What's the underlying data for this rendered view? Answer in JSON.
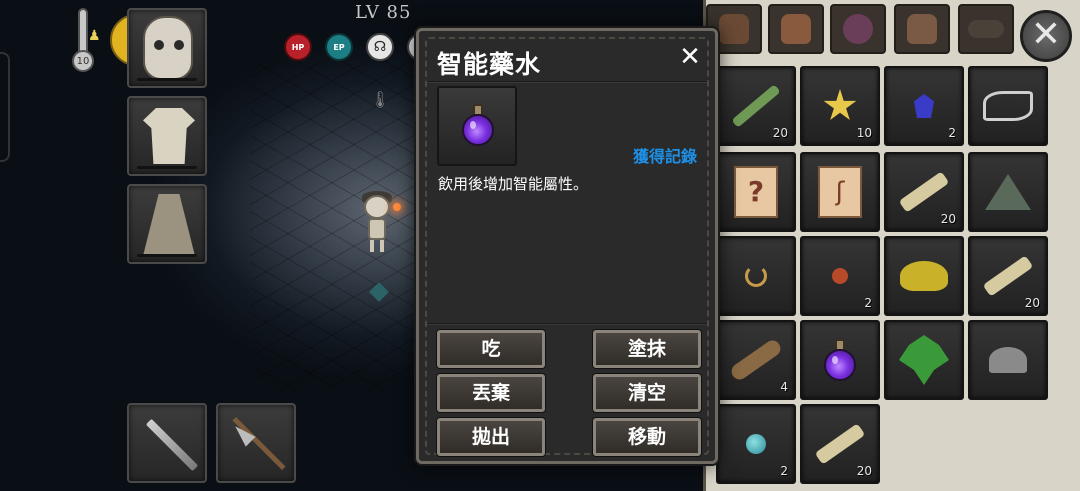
{
  "hud": {
    "level": "LV 85",
    "temperature": "10",
    "stats": [
      "HP",
      "EP"
    ]
  },
  "modal": {
    "title": "智能藥水",
    "close_symbol": "✕",
    "obtain_record": "獲得記錄",
    "description": "飲用後增加智能屬性。",
    "buttons": {
      "eat": "吃",
      "smear": "塗抹",
      "discard": "丟棄",
      "clear": "清空",
      "throw": "拋出",
      "move": "移動"
    }
  },
  "inventory": {
    "close_symbol": "✕",
    "bag_tabs": [
      {
        "name": "backpack-brown"
      },
      {
        "name": "backpack-orange"
      },
      {
        "name": "pouch-purple"
      },
      {
        "name": "backpack-tan"
      },
      {
        "name": "creature-bag"
      }
    ],
    "items": [
      {
        "name": "grass-bundle",
        "count": "20"
      },
      {
        "name": "star-crystal",
        "count": "10"
      },
      {
        "name": "dark-gem",
        "count": "2"
      },
      {
        "name": "skeleton-fossil",
        "count": ""
      },
      {
        "name": "mystery-scroll",
        "count": ""
      },
      {
        "name": "rune-scroll",
        "count": ""
      },
      {
        "name": "straw-bundle",
        "count": "20"
      },
      {
        "name": "tent-cloth",
        "count": ""
      },
      {
        "name": "worm",
        "count": ""
      },
      {
        "name": "red-berry",
        "count": "2"
      },
      {
        "name": "yellow-powder",
        "count": ""
      },
      {
        "name": "straw-bundle",
        "count": "20"
      },
      {
        "name": "wood-log",
        "count": "4"
      },
      {
        "name": "intelligence-potion",
        "count": ""
      },
      {
        "name": "green-leaves",
        "count": ""
      },
      {
        "name": "gray-mushroom",
        "count": ""
      },
      {
        "name": "blue-orb",
        "count": "2"
      },
      {
        "name": "straw-bundle",
        "count": "20"
      }
    ]
  },
  "colors": {
    "link_blue": "#1e90e8",
    "modal_bg": "#2a2a2a",
    "potion_purple": "#7a2fe0"
  }
}
